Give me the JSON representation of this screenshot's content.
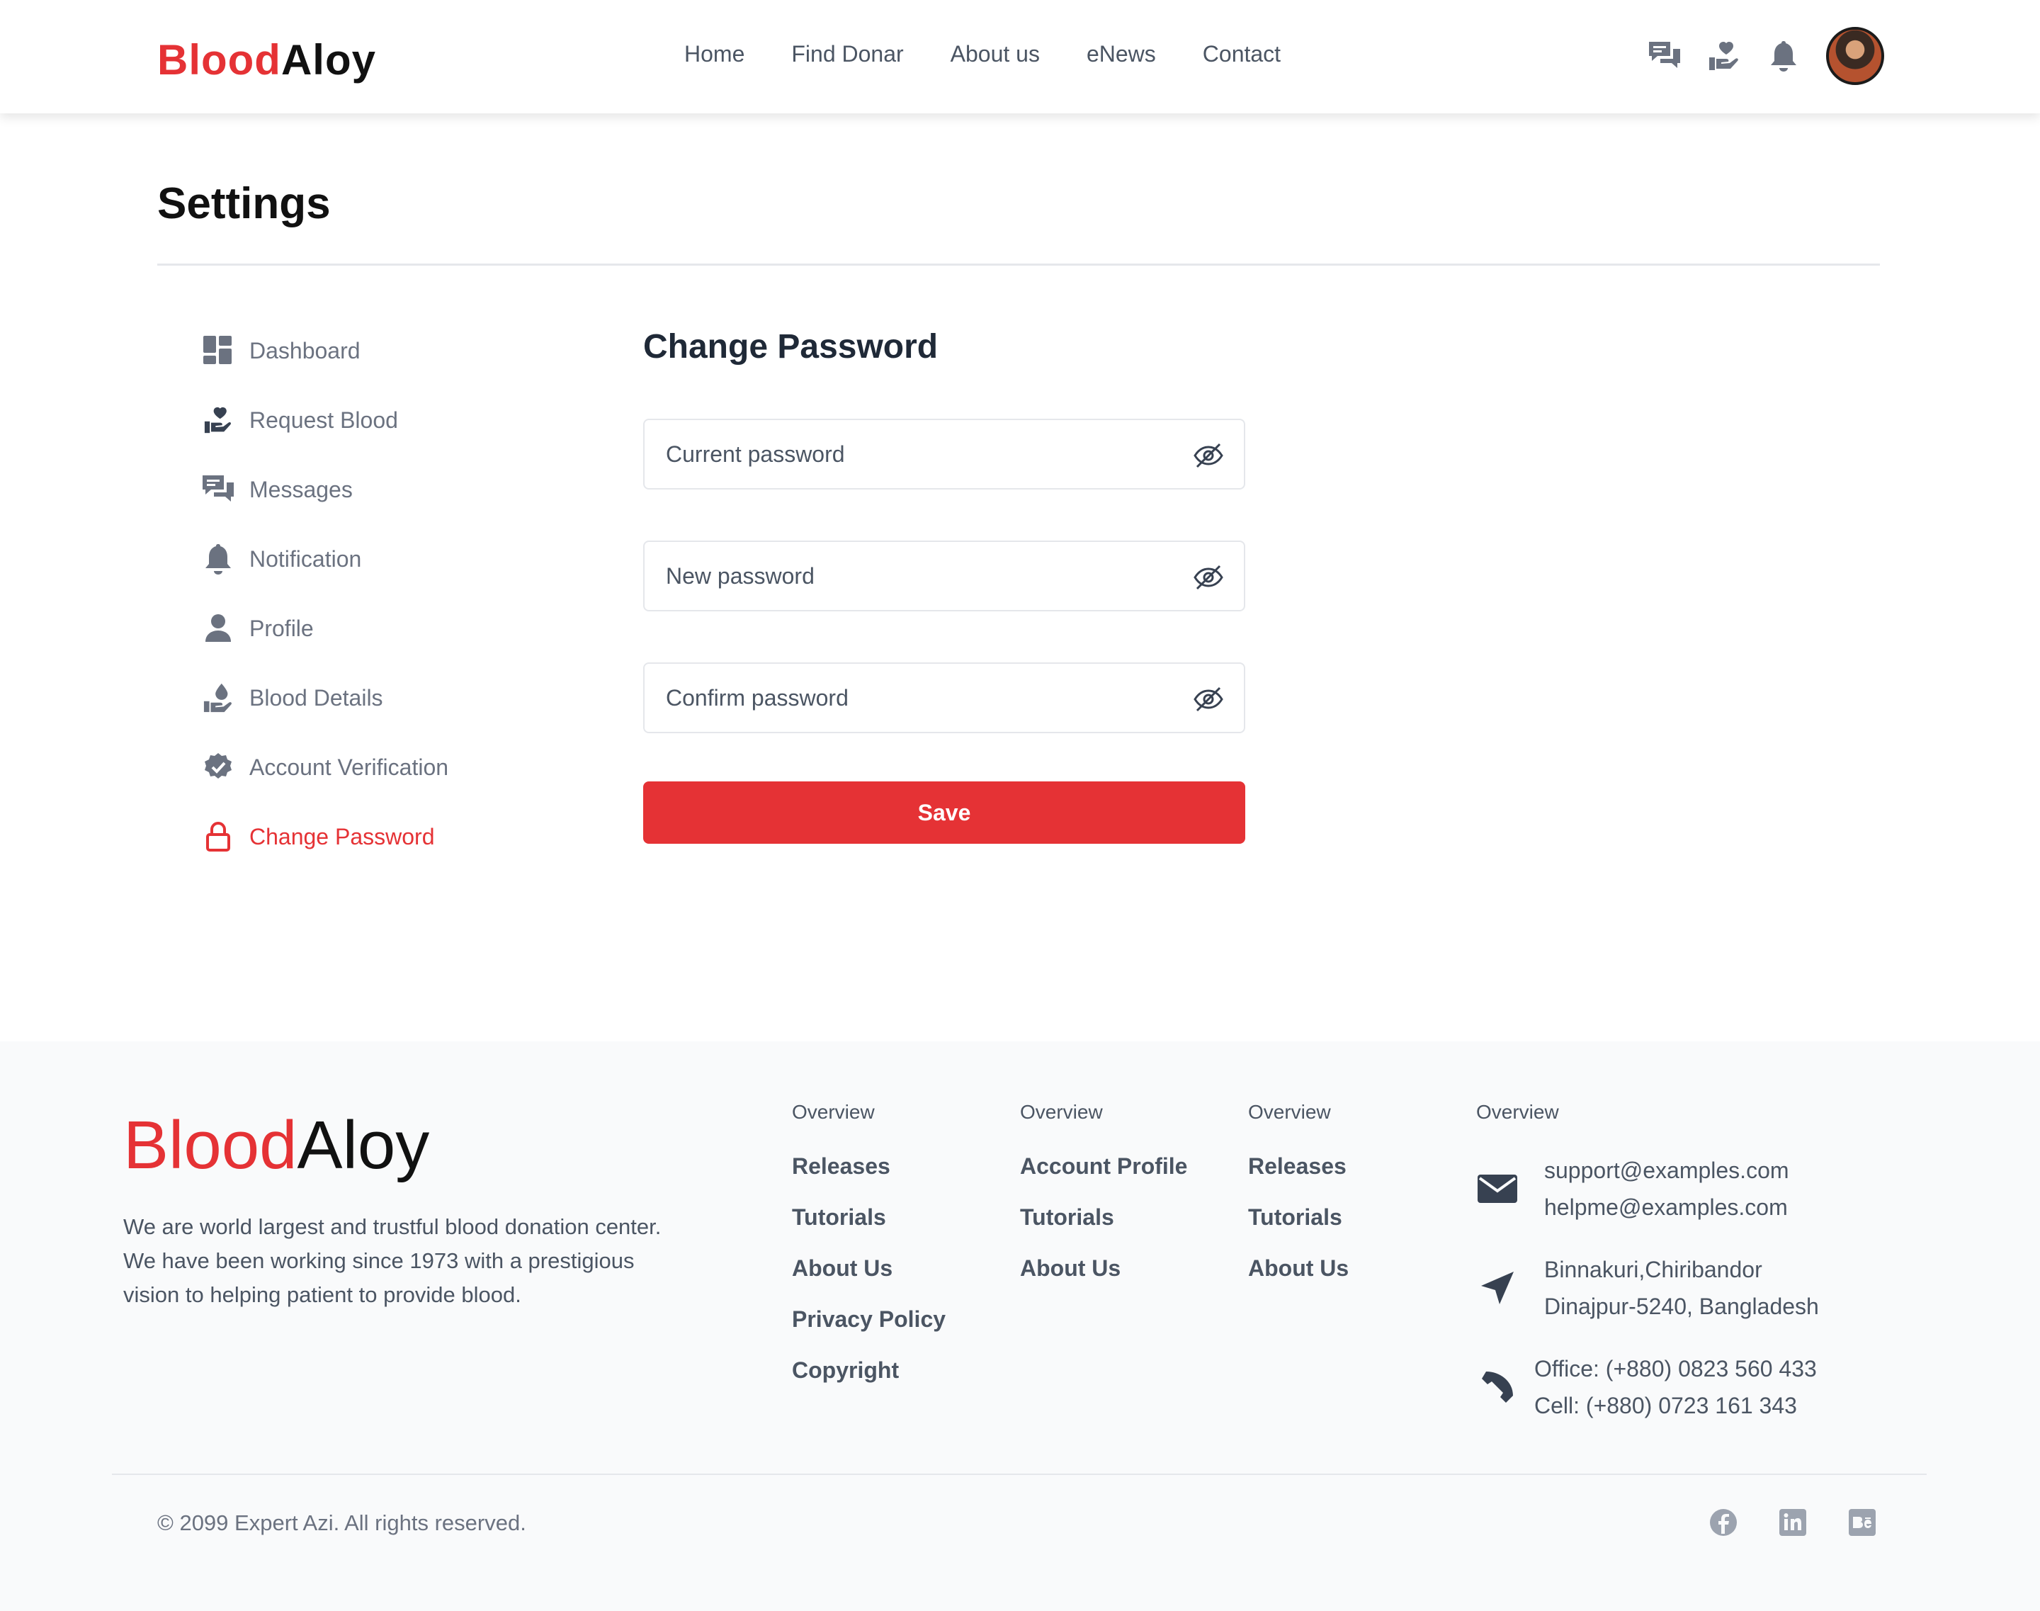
{
  "brand": {
    "part1": "Blood",
    "part2": "Aloy"
  },
  "nav": [
    "Home",
    "Find Donar",
    "About us",
    "eNews",
    "Contact"
  ],
  "header_icons": [
    "messages-icon",
    "hand-heart-icon",
    "bell-icon"
  ],
  "page_title": "Settings",
  "sidebar": [
    {
      "label": "Dashboard",
      "icon": "dashboard-icon"
    },
    {
      "label": "Request Blood",
      "icon": "hand-heart-icon"
    },
    {
      "label": "Messages",
      "icon": "messages-icon"
    },
    {
      "label": "Notification",
      "icon": "bell-icon"
    },
    {
      "label": "Profile",
      "icon": "user-icon"
    },
    {
      "label": "Blood Details",
      "icon": "blood-drop-hand-icon"
    },
    {
      "label": "Account Verification",
      "icon": "verified-badge-icon"
    },
    {
      "label": "Change Password",
      "icon": "lock-icon",
      "active": true
    }
  ],
  "form": {
    "title": "Change Password",
    "current_placeholder": "Current password",
    "new_placeholder": "New password",
    "confirm_placeholder": "Confirm password",
    "save_label": "Save"
  },
  "footer": {
    "description": "We are world largest and trustful blood donation center. We have been working since 1973 with a prestigious vision to helping patient to provide blood.",
    "columns": [
      {
        "heading": "Overview",
        "links": [
          "Releases",
          "Tutorials",
          "About Us",
          "Privacy Policy",
          "Copyright"
        ]
      },
      {
        "heading": "Overview",
        "links": [
          "Account Profile",
          "Tutorials",
          "About Us"
        ]
      },
      {
        "heading": "Overview",
        "links": [
          "Releases",
          "Tutorials",
          "About Us"
        ]
      }
    ],
    "contact": {
      "heading": "Overview",
      "emails": [
        "support@examples.com",
        "helpme@examples.com"
      ],
      "address": [
        "Binnakuri,Chiribandor",
        "Dinajpur-5240, Bangladesh"
      ],
      "phones": [
        "Office: (+880) 0823 560 433",
        "Cell: (+880) 0723 161 343"
      ]
    },
    "copyright": "© 2099 Expert Azi. All rights reserved.",
    "social": [
      "facebook-icon",
      "linkedin-icon",
      "behance-icon"
    ]
  },
  "colors": {
    "accent": "#e53235",
    "text_muted": "#6b7280",
    "icon_gray": "#6b7280"
  }
}
